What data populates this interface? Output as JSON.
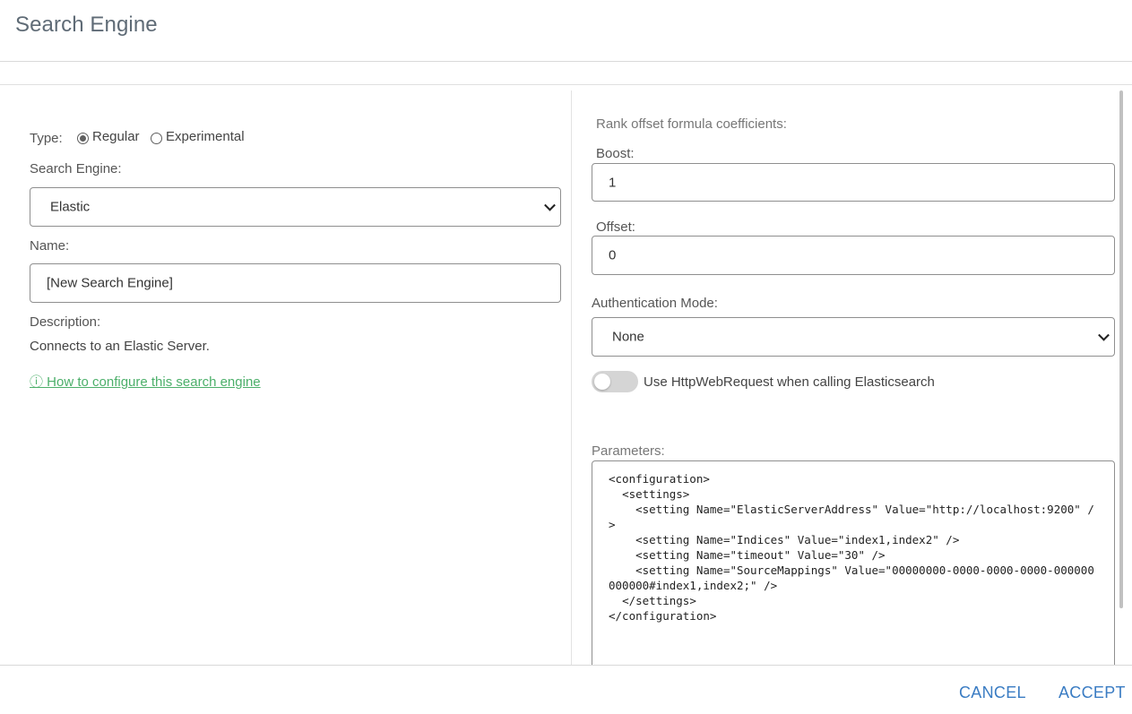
{
  "dialog": {
    "title": "Search Engine"
  },
  "left": {
    "type_label": "Type:",
    "type_options": [
      {
        "label": "Regular",
        "selected": true
      },
      {
        "label": "Experimental",
        "selected": false
      }
    ],
    "search_engine_label": "Search Engine:",
    "search_engine_value": "Elastic",
    "name_label": "Name:",
    "name_value": "[New Search Engine]",
    "description_label": "Description:",
    "description_text": "Connects to an Elastic Server.",
    "help_link": "ⓘ How to configure this search engine"
  },
  "right": {
    "rank_label": "Rank offset formula coefficients:",
    "boost_label": "Boost:",
    "boost_value": "1",
    "offset_label": "Offset:",
    "offset_value": "0",
    "auth_label": "Authentication Mode:",
    "auth_value": "None",
    "toggle_label": "Use HttpWebRequest when calling Elasticsearch",
    "toggle_on": false,
    "parameters_label": "Parameters:",
    "parameters_value": "<configuration>\n  <settings>\n    <setting Name=\"ElasticServerAddress\" Value=\"http://localhost:9200\" />\n    <setting Name=\"Indices\" Value=\"index1,index2\" />\n    <setting Name=\"timeout\" Value=\"30\" />\n    <setting Name=\"SourceMappings\" Value=\"00000000-0000-0000-0000-000000000000#index1,index2;\" />\n  </settings>\n</configuration>"
  },
  "footer": {
    "cancel_label": "CANCEL",
    "accept_label": "ACCEPT"
  },
  "colors": {
    "accent": "#3a7cc3",
    "link": "#4caf6a",
    "title": "#5f6b76"
  }
}
